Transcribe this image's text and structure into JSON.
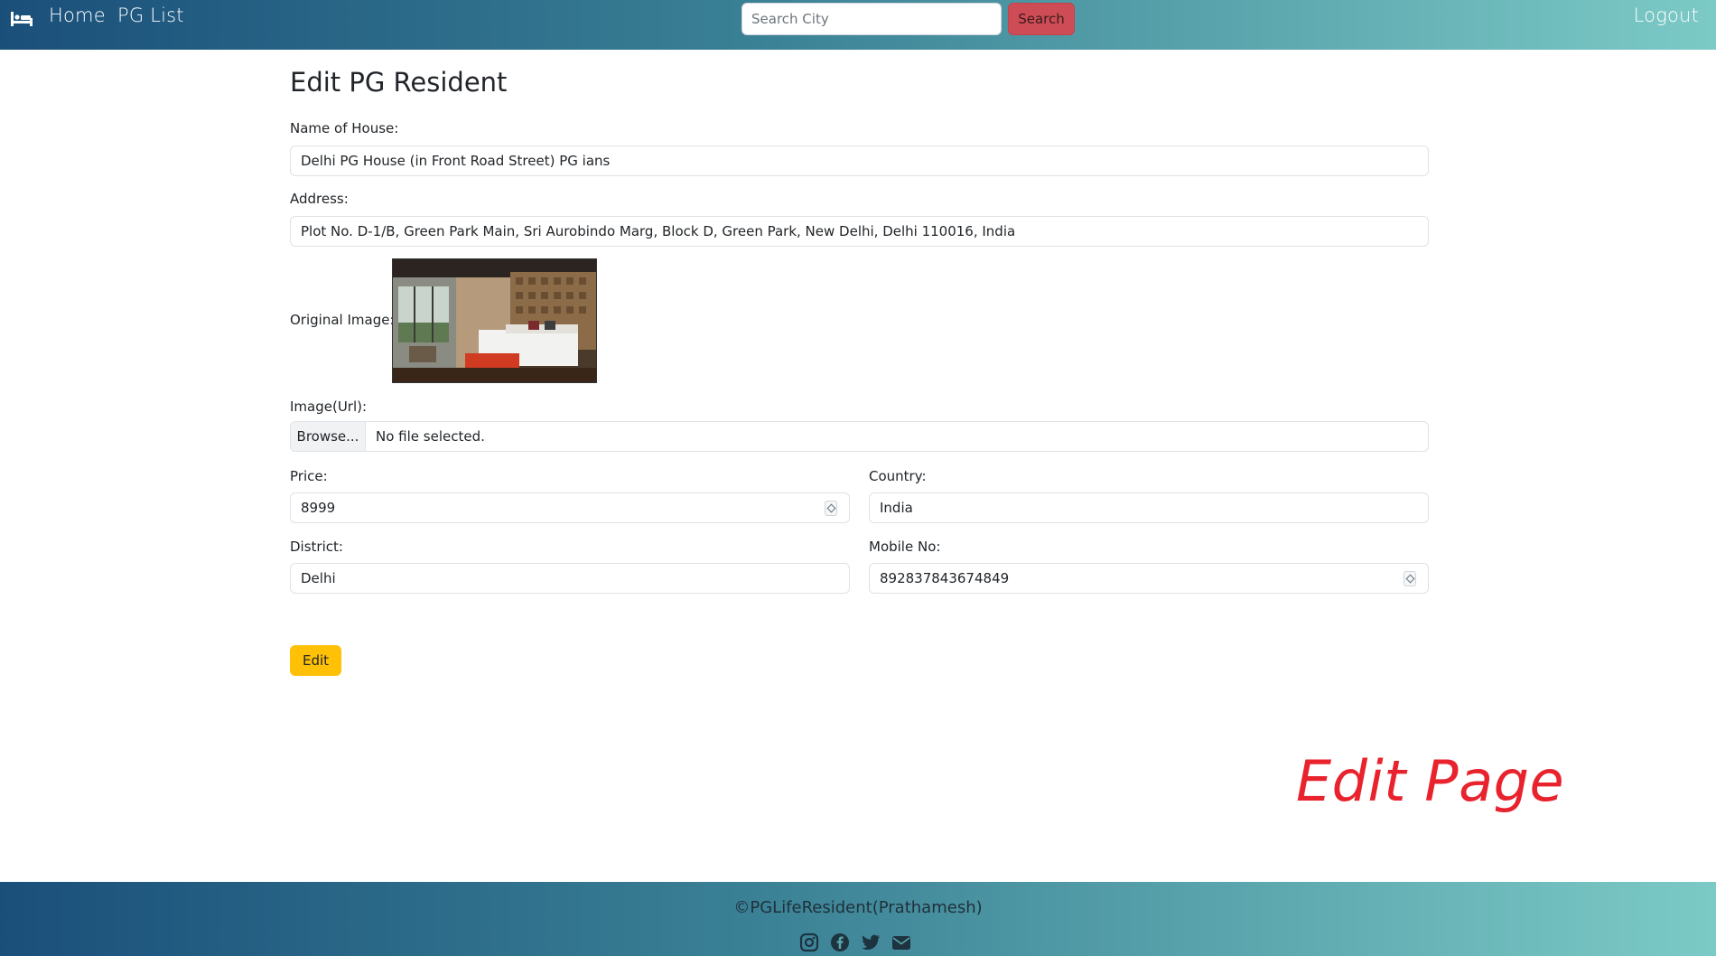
{
  "nav": {
    "home_label": "Home",
    "pglist_label": "PG List",
    "search_placeholder": "Search City",
    "search_label": "Search",
    "logout_label": "Logout",
    "brand_icon": "bed-icon"
  },
  "form": {
    "title": "Edit PG Resident",
    "name_label": "Name of House:",
    "name_value": "Delhi PG House (in Front Road Street) PG ians",
    "address_label": "Address:",
    "address_value": "Plot No. D-1/B, Green Park Main, Sri Aurobindo Marg, Block D, Green Park, New Delhi, Delhi 110016, India",
    "original_image_label": "Original Image:",
    "image_url_label": "Image(Url):",
    "browse_label": "Browse...",
    "file_status": "No file selected.",
    "price_label": "Price:",
    "price_value": "8999",
    "country_label": "Country:",
    "country_value": "India",
    "district_label": "District:",
    "district_value": "Delhi",
    "mobile_label": "Mobile No:",
    "mobile_value": "892837843674849",
    "edit_label": "Edit"
  },
  "overlay": {
    "caption": "Edit Page"
  },
  "footer": {
    "copyright": "©PGLifeResident(Prathamesh)",
    "icons": [
      "instagram-icon",
      "facebook-icon",
      "twitter-icon",
      "mail-icon"
    ]
  },
  "colors": {
    "nav_gradient_start": "#1a4f7a",
    "nav_gradient_end": "#7ccac6",
    "search_button": "#cd4c55",
    "edit_button": "#ffc107",
    "caption": "#e8232e"
  }
}
